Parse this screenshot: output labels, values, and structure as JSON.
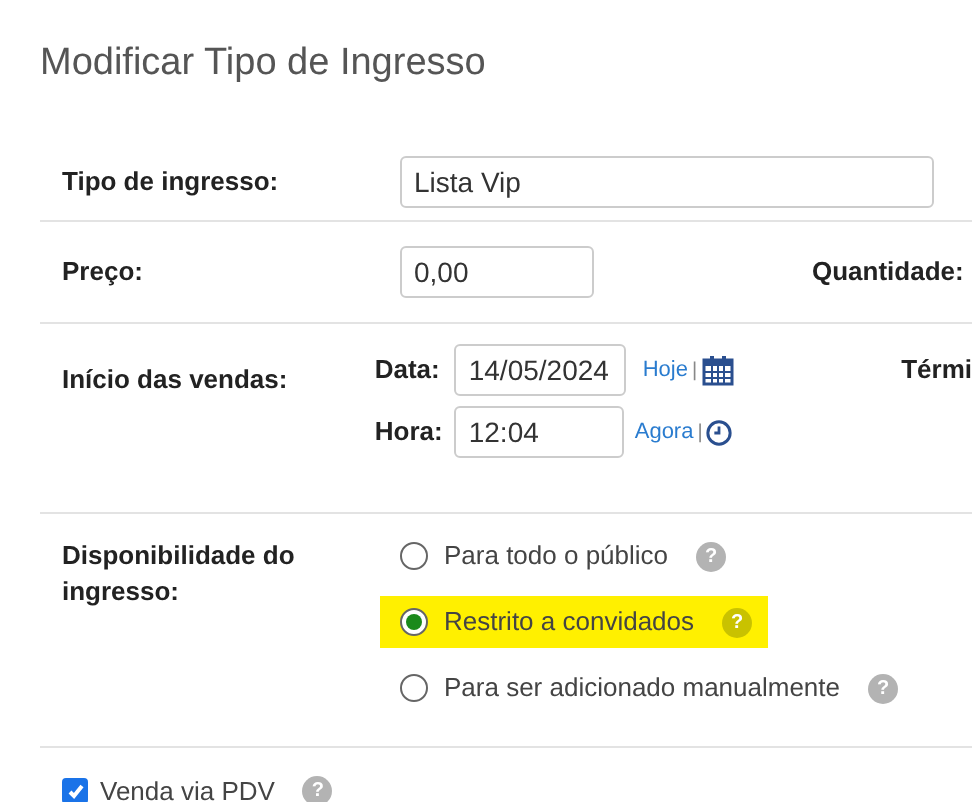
{
  "title": "Modificar Tipo de Ingresso",
  "ticket_type": {
    "label": "Tipo de ingresso:",
    "value": "Lista Vip"
  },
  "price": {
    "label": "Preço:",
    "value": "0,00",
    "quantity_label": "Quantidade:"
  },
  "sales_start": {
    "label": "Início das vendas:",
    "date_label": "Data:",
    "date": "14/05/2024",
    "today_link": "Hoje",
    "separator_1": "|",
    "time_label": "Hora:",
    "time": "12:04",
    "now_link": "Agora",
    "separator_2": "|",
    "end_label": "Térmi"
  },
  "availability": {
    "label": "Disponibilidade do ingresso:",
    "options": [
      {
        "label": "Para todo o público",
        "selected": false,
        "help": "?"
      },
      {
        "label": "Restrito a convidados",
        "selected": true,
        "help": "?"
      },
      {
        "label": "Para ser adicionado manualmente",
        "selected": false,
        "help": "?"
      }
    ]
  },
  "pdv": {
    "label": "Venda via PDV",
    "checked": true,
    "help": "?"
  }
}
